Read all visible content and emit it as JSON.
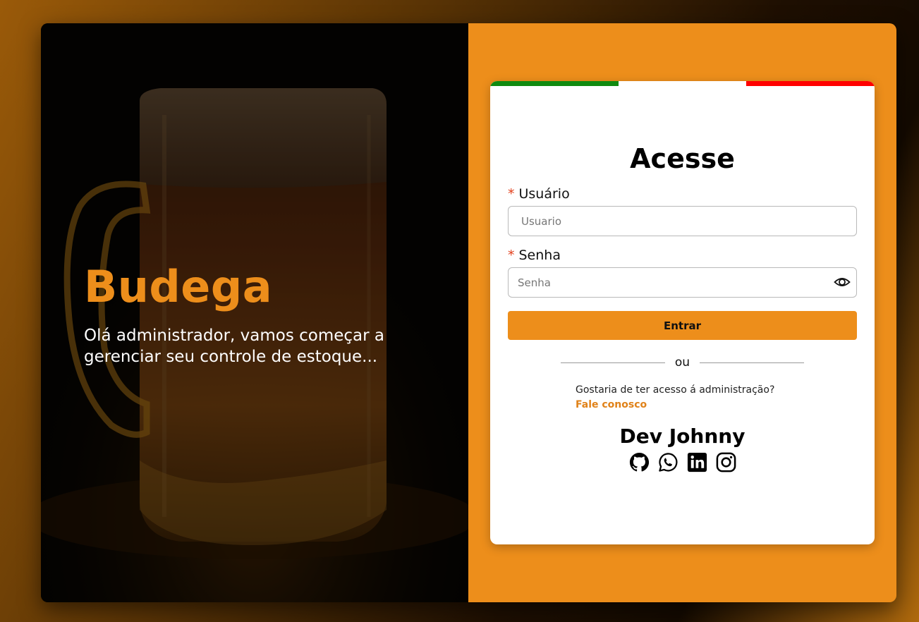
{
  "hero": {
    "brand": "Budega",
    "tagline": "Olá administrador, vamos começar a gerenciar seu controle de estoque..."
  },
  "login": {
    "title": "Acesse",
    "username": {
      "required_mark": "*",
      "label": "Usuário",
      "placeholder": "Usuario",
      "value": ""
    },
    "password": {
      "required_mark": "*",
      "label": "Senha",
      "placeholder": "Senha",
      "value": ""
    },
    "submit_label": "Entrar",
    "divider_text": "ou",
    "request_question": "Gostaria de ter acesso á administração?",
    "contact_link": "Fale conosco"
  },
  "footer": {
    "dev_name": "Dev Johnny",
    "socials": [
      "github-icon",
      "whatsapp-icon",
      "linkedin-icon",
      "instagram-icon"
    ]
  },
  "colors": {
    "accent": "#ed8e1b",
    "flag_green": "#108a10",
    "flag_white": "#ffffff",
    "flag_red": "#ff0000"
  }
}
